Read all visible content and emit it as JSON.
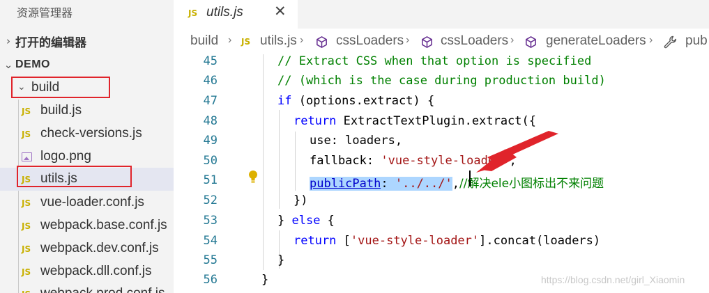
{
  "sidebar": {
    "title": "资源管理器",
    "open_editors": "打开的编辑器",
    "workspace": "DEMO",
    "folder": "build",
    "files": [
      {
        "name": "build.js",
        "icon": "js-file-icon"
      },
      {
        "name": "check-versions.js",
        "icon": "js-file-icon"
      },
      {
        "name": "logo.png",
        "icon": "image-file-icon"
      },
      {
        "name": "utils.js",
        "icon": "js-file-icon",
        "selected": true
      },
      {
        "name": "vue-loader.conf.js",
        "icon": "js-file-icon"
      },
      {
        "name": "webpack.base.conf.js",
        "icon": "js-file-icon"
      },
      {
        "name": "webpack.dev.conf.js",
        "icon": "js-file-icon"
      },
      {
        "name": "webpack.dll.conf.js",
        "icon": "js-file-icon"
      },
      {
        "name": "webpack.prod.conf.js",
        "icon": "js-file-icon"
      }
    ]
  },
  "tab": {
    "icon_label": "JS",
    "name": "utils.js",
    "close": "✕"
  },
  "breadcrumb": {
    "items": [
      "build",
      "utils.js",
      "cssLoaders",
      "cssLoaders",
      "generateLoaders",
      "pub"
    ]
  },
  "editor": {
    "lines": [
      {
        "n": "45",
        "text": "// Extract CSS when that option is specified"
      },
      {
        "n": "46",
        "text": "// (which is the case during production build)"
      },
      {
        "n": "47",
        "kw": "if",
        "rest": " (options.extract) {"
      },
      {
        "n": "48",
        "kw": "return",
        "rest": " ExtractTextPlugin.extract({"
      },
      {
        "n": "49",
        "text": "use: loaders,"
      },
      {
        "n": "50",
        "key": "fallback: ",
        "str": "'vue-style-loader'",
        "tail": ","
      },
      {
        "n": "51",
        "key": "publicPath",
        "colon": ":",
        "str": "'../../'",
        "tail": ",",
        "comment": "//解决ele小图标出不来问题"
      },
      {
        "n": "52",
        "text": "})"
      },
      {
        "n": "53",
        "pre": "} ",
        "kw": "else",
        "rest": " {"
      },
      {
        "n": "54",
        "kw": "return",
        "pre2": " [",
        "str": "'vue-style-loader'",
        "rest": "].concat(loaders)"
      },
      {
        "n": "55",
        "text": "}"
      },
      {
        "n": "56",
        "text": "}"
      }
    ]
  },
  "watermark": "https://blog.csdn.net/girl_Xiaomin",
  "colors": {
    "annotation_red": "#e0242b",
    "selection": "#add6ff",
    "comment": "#008000",
    "keyword": "#0000ff",
    "string": "#a31515",
    "line_number": "#237893"
  }
}
